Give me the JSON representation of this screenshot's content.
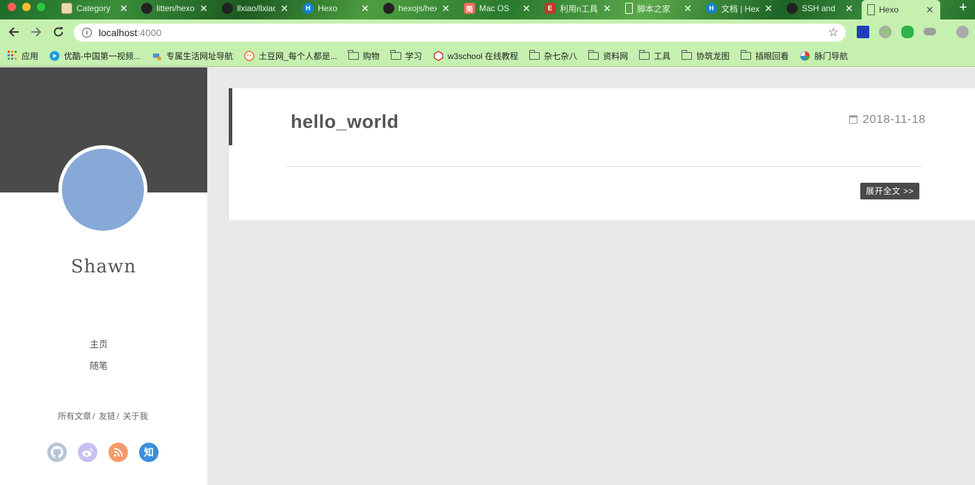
{
  "browser": {
    "tabs": [
      {
        "title": "Category",
        "favicon": "map-icon",
        "color": "#e9d9b0"
      },
      {
        "title": "litten/hexo",
        "favicon": "github-icon",
        "color": "#222222"
      },
      {
        "title": "llxiao/llxiao",
        "favicon": "github-icon",
        "color": "#222222"
      },
      {
        "title": "Hexo",
        "favicon": "hexo-icon",
        "color": "#0e83cd"
      },
      {
        "title": "hexojs/hexo",
        "favicon": "github-icon",
        "color": "#222222"
      },
      {
        "title": "Mac OS",
        "favicon": "jianshu-icon",
        "color": "#ea6f5a"
      },
      {
        "title": "利用n工具",
        "favicon": "doc-red-icon",
        "color": "#c0392b"
      },
      {
        "title": "脚本之家",
        "favicon": "doc-icon",
        "color": "#ffffff"
      },
      {
        "title": "文档 | Hexo",
        "favicon": "hexo-icon",
        "color": "#0e83cd"
      },
      {
        "title": "SSH and",
        "favicon": "github-icon",
        "color": "#222222"
      }
    ],
    "active_tab": {
      "title": "Hexo",
      "favicon": "doc-icon"
    },
    "url_host": "localhost",
    "url_port": ":4000",
    "bookmarks": [
      {
        "label": "应用",
        "icon": "apps-grid-icon"
      },
      {
        "label": "优酷-中国第一视频...",
        "icon": "youku-icon"
      },
      {
        "label": "专属生活网址导航",
        "icon": "nav-icon"
      },
      {
        "label": "土豆网_每个人都是...",
        "icon": "tudou-icon"
      },
      {
        "label": "购物",
        "icon": "folder-icon"
      },
      {
        "label": "学习",
        "icon": "folder-icon"
      },
      {
        "label": "w3school 在线教程",
        "icon": "w3school-icon"
      },
      {
        "label": "杂七杂八",
        "icon": "folder-icon"
      },
      {
        "label": "资料网",
        "icon": "folder-icon"
      },
      {
        "label": "工具",
        "icon": "folder-icon"
      },
      {
        "label": "协筑龙图",
        "icon": "folder-icon"
      },
      {
        "label": "插眼回看",
        "icon": "folder-icon"
      },
      {
        "label": "脉门导航",
        "icon": "maimen-icon"
      }
    ]
  },
  "sidebar": {
    "author": "Shawn",
    "menu": [
      "主页",
      "随笔"
    ],
    "links": [
      "所有文章",
      "友链",
      "关于我"
    ],
    "link_separator": "/",
    "social": [
      {
        "name": "github-icon",
        "glyph": "",
        "color": "#b7c4d6"
      },
      {
        "name": "weibo-icon",
        "glyph": "",
        "color": "#c7c0f0"
      },
      {
        "name": "rss-icon",
        "glyph": "",
        "color": "#f79a67"
      },
      {
        "name": "zhihu-icon",
        "glyph": "知",
        "color": "#3b8fd9"
      }
    ]
  },
  "post": {
    "title": "hello_world",
    "date": "2018-11-18",
    "more_label": "展开全文 >>"
  }
}
